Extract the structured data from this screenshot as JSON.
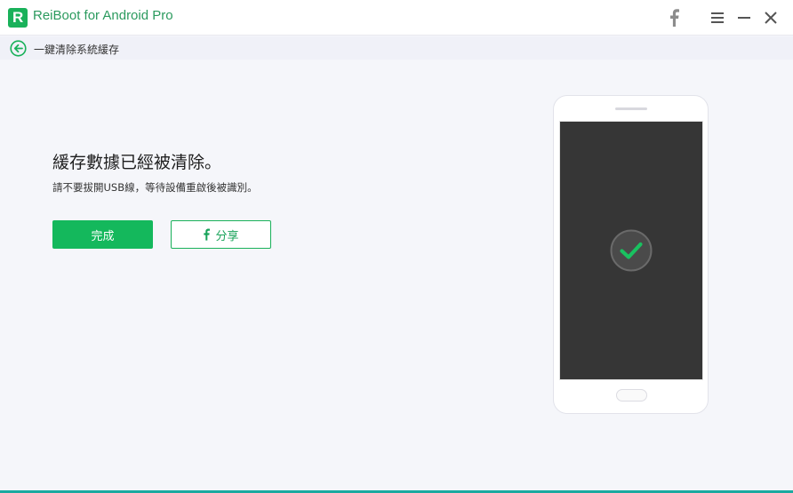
{
  "app": {
    "logo_letter": "R",
    "title": "ReiBoot for Android Pro"
  },
  "titlebar": {
    "icons": [
      "facebook-icon",
      "menu-icon",
      "minimize-icon",
      "close-icon"
    ]
  },
  "subbar": {
    "breadcrumb": "一鍵清除系統緩存"
  },
  "main": {
    "title": "緩存數據已經被清除。",
    "subtitle": "請不要拔開USB線，等待設備重啟後被識別。",
    "done_label": "完成",
    "share_label": "分享"
  },
  "colors": {
    "brand_green": "#19b15a",
    "screen": "#363636",
    "accent_line": "#1aa9a0"
  }
}
